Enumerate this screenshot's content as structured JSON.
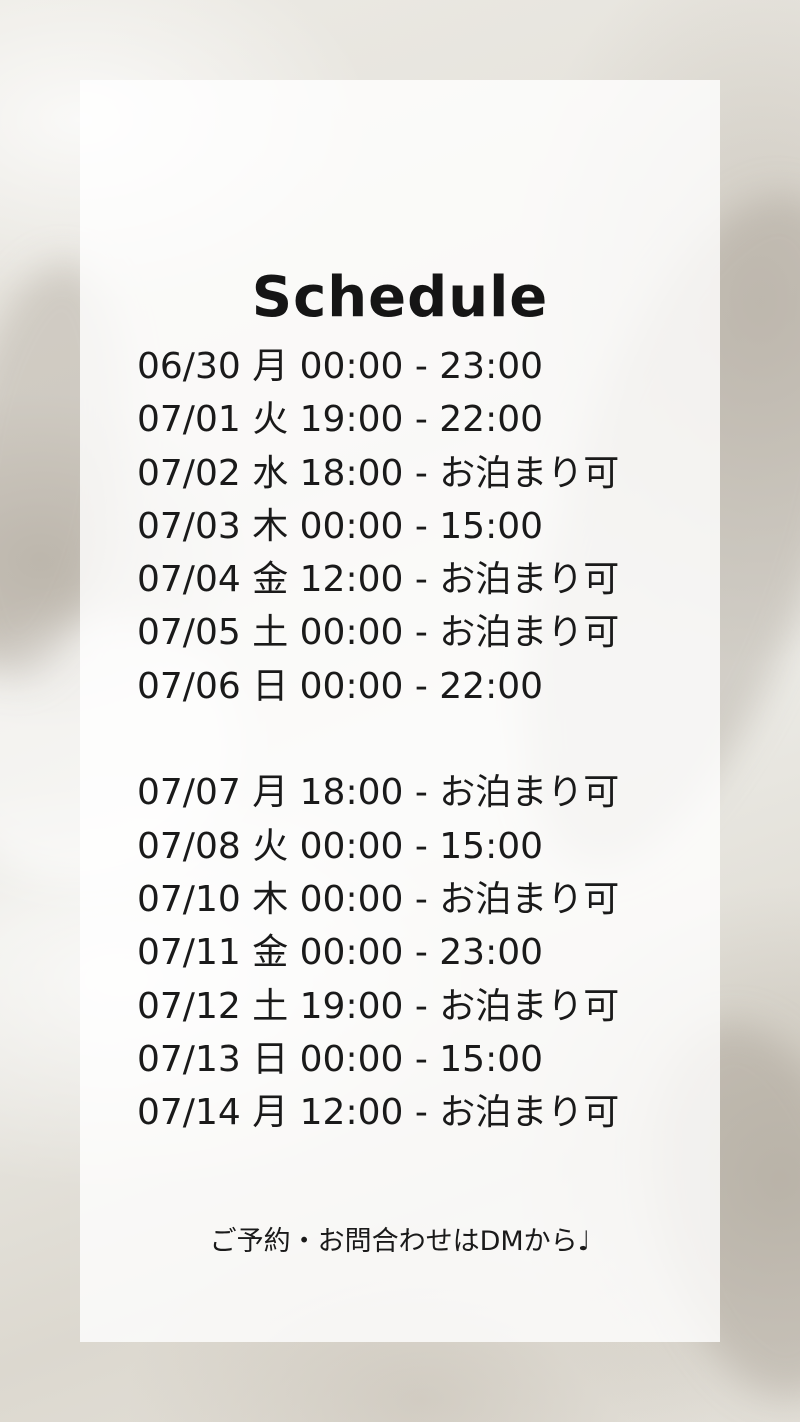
{
  "title": "Schedule",
  "schedule": [
    "06/30 月 00:00 - 23:00",
    "07/01 火 19:00 - 22:00",
    "07/02 水 18:00 - お泊まり可",
    "07/03 木 00:00 - 15:00",
    "07/04 金 12:00 - お泊まり可",
    "07/05 土 00:00 - お泊まり可",
    "07/06 日 00:00 - 22:00",
    "07/07 月 18:00 - お泊まり可",
    "07/08 火 00:00 - 15:00",
    "07/10 木 00:00 - お泊まり可",
    "07/11 金 00:00 - 23:00",
    "07/12 土 19:00 - お泊まり可",
    "07/13 日 00:00 - 15:00",
    "07/14 月 12:00 - お泊まり可"
  ],
  "footer": "ご予約・お問合わせはDMから♩"
}
